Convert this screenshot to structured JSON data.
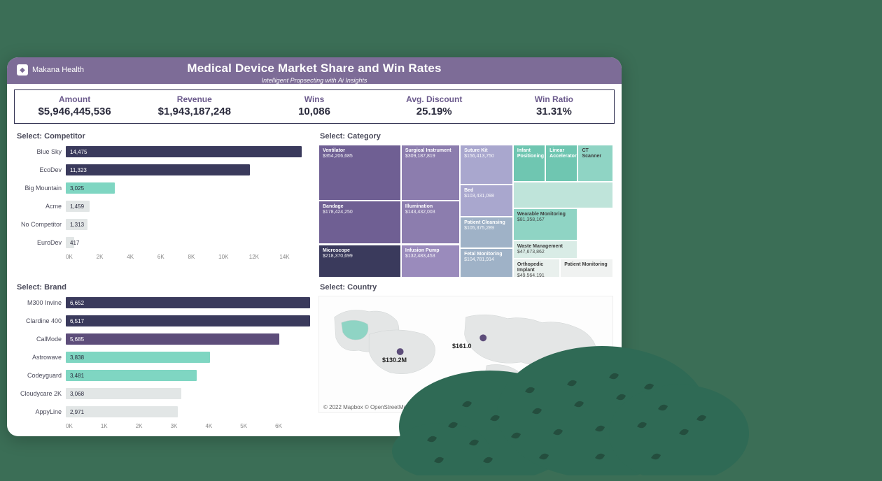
{
  "brand": {
    "name": "Makana Health"
  },
  "header": {
    "title": "Medical Device Market Share and Win Rates",
    "subtitle": "Intelligent Propsecting with Ai Insights"
  },
  "kpis": [
    {
      "label": "Amount",
      "value": "$5,946,445,536"
    },
    {
      "label": "Revenue",
      "value": "$1,943,187,248"
    },
    {
      "label": "Wins",
      "value": "10,086"
    },
    {
      "label": "Avg. Discount",
      "value": "25.19%"
    },
    {
      "label": "Win Ratio",
      "value": "31.31%"
    }
  ],
  "competitor": {
    "title": "Select: Competitor",
    "axis": [
      "0K",
      "2K",
      "4K",
      "6K",
      "8K",
      "10K",
      "12K",
      "14K"
    ]
  },
  "brandChart": {
    "title": "Select: Brand",
    "axis": [
      "0K",
      "1K",
      "2K",
      "3K",
      "4K",
      "5K",
      "6K"
    ]
  },
  "category": {
    "title": "Select: Category"
  },
  "country": {
    "title": "Select: Country"
  },
  "map": {
    "labels": [
      {
        "text": "$130.2M"
      },
      {
        "text": "$161.0"
      }
    ],
    "attribution": "© 2022 Mapbox © OpenStreetMap"
  },
  "chart_data": {
    "competitor_bar": {
      "type": "bar",
      "orientation": "horizontal",
      "xlabel": "",
      "ylabel": "",
      "xlim": [
        0,
        15000
      ],
      "categories": [
        "Blue Sky",
        "EcoDev",
        "Big Mountain",
        "Acme",
        "No Competitor",
        "EuroDev"
      ],
      "values": [
        14475,
        11323,
        3025,
        1459,
        1313,
        417
      ],
      "colors": [
        "dark",
        "dark",
        "mint",
        "grey",
        "grey",
        "grey"
      ]
    },
    "brand_bar": {
      "type": "bar",
      "orientation": "horizontal",
      "xlabel": "",
      "ylabel": "",
      "xlim": [
        0,
        6500
      ],
      "categories": [
        "M300 Invine",
        "Clardine 400",
        "CalMode",
        "Astrowave",
        "Codeyguard",
        "Cloudycare 2K",
        "AppyLine"
      ],
      "values": [
        6652,
        6517,
        5685,
        3838,
        3481,
        3068,
        2971
      ],
      "colors": [
        "dark",
        "dark",
        "purp",
        "mint",
        "mint",
        "grey",
        "grey"
      ]
    },
    "category_treemap": {
      "type": "treemap",
      "items": [
        {
          "name": "Ventilator",
          "label": "$354,206,685",
          "value": 354206685,
          "color": "#6f5f93"
        },
        {
          "name": "Microscope",
          "label": "$218,370,699",
          "value": 218370699,
          "color": "#3a3a5c"
        },
        {
          "name": "Bandage",
          "label": "$178,424,250",
          "value": 178424250,
          "color": "#6f5f93"
        },
        {
          "name": "Surgical Instrument",
          "label": "$309,187,819",
          "value": 309187819,
          "color": "#8c7dae"
        },
        {
          "name": "Illumination",
          "label": "$143,432,003",
          "value": 143432003,
          "color": "#8c7dae"
        },
        {
          "name": "Infusion Pump",
          "label": "$132,483,453",
          "value": 132483453,
          "color": "#9a8bbc"
        },
        {
          "name": "Suture Kit",
          "label": "$156,413,750",
          "value": 156413750,
          "color": "#a9a7ce"
        },
        {
          "name": "Bed",
          "label": "$103,431,098",
          "value": 103431098,
          "color": "#a9a7ce"
        },
        {
          "name": "Patient Cleansing",
          "label": "$105,375,289",
          "value": 105375289,
          "color": "#9fb2c7"
        },
        {
          "name": "Fetal Monitoring",
          "label": "$104,781,914",
          "value": 104781914,
          "color": "#9fb2c7"
        },
        {
          "name": "Infant Positioning",
          "label": "",
          "value": 60000000,
          "color": "#6fc6b1"
        },
        {
          "name": "Linear Accelerator",
          "label": "",
          "value": 55000000,
          "color": "#6fc6b1"
        },
        {
          "name": "CT Scanner",
          "label": "",
          "value": 55000000,
          "color": "#8fd4c4"
        },
        {
          "name": "Wearable Monitoring",
          "label": "$81,358,167",
          "value": 81358167,
          "color": "#8fd4c4"
        },
        {
          "name": "Waste Management",
          "label": "$47,673,862",
          "value": 47673862,
          "color": "#d9ece6"
        },
        {
          "name": "Orthopedic Implant",
          "label": "$49,564,191",
          "value": 49564191,
          "color": "#e9f0ed"
        },
        {
          "name": "Patient Monitoring",
          "label": "",
          "value": 35000000,
          "color": "#f0f2f1"
        },
        {
          "name": "",
          "label": "",
          "value": 50000000,
          "color": "#bfe4da"
        }
      ]
    },
    "country_map": {
      "type": "map",
      "points": [
        {
          "label": "$130.2M",
          "region": "North America"
        },
        {
          "label": "$161.0",
          "region": "Europe/Asia"
        }
      ]
    }
  }
}
